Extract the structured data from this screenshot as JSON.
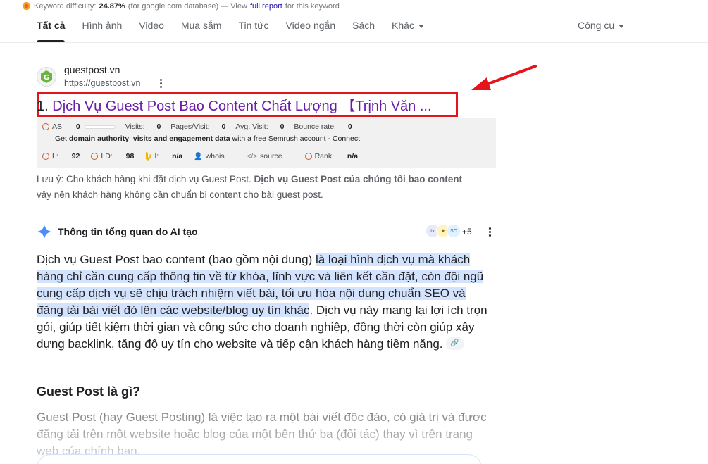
{
  "keyword_difficulty": {
    "label": "Keyword difficulty:",
    "value": "24.87%",
    "note": "(for google.com database) — View",
    "link": "full report",
    "suffix": "for this keyword"
  },
  "tabs": [
    {
      "label": "Tất cả",
      "active": true
    },
    {
      "label": "Hình ảnh"
    },
    {
      "label": "Video"
    },
    {
      "label": "Mua sắm"
    },
    {
      "label": "Tin tức"
    },
    {
      "label": "Video ngắn"
    },
    {
      "label": "Sách"
    },
    {
      "label": "Khác"
    }
  ],
  "tools_label": "Công cụ",
  "result": {
    "site_name": "guestpost.vn",
    "url": "https://guestpost.vn",
    "number": "1.",
    "title": "Dịch Vụ Guest Post Bao Content Chất Lượng 【Trịnh Văn ...",
    "title_color": "#681da8",
    "highlight_color": "#e5141b",
    "semrush": {
      "as_label": "AS:",
      "as_value": "0",
      "visits_label": "Visits:",
      "visits_value": "0",
      "pages_label": "Pages/Visit:",
      "pages_value": "0",
      "avg_label": "Avg. Visit:",
      "avg_value": "0",
      "bounce_label": "Bounce rate:",
      "bounce_value": "0",
      "promo_1": "Get",
      "promo_2": "domain authority",
      "promo_3": ",",
      "promo_4": "visits and engagement data",
      "promo_5": "with a free Semrush account -",
      "connect": "Connect",
      "l_label": "L:",
      "l_value": "92",
      "ld_label": "LD:",
      "ld_value": "98",
      "i_label": "I:",
      "i_value": "n/a",
      "whois": "whois",
      "source": "source",
      "rank_label": "Rank:",
      "rank_value": "n/a"
    },
    "snippet_1": "Lưu ý: Cho khách hàng khi đặt dịch vụ Guest Post.",
    "snippet_bold": "Dịch vụ Guest Post của chúng tôi bao content",
    "snippet_2": "vậy nên khách hàng không cần chuẩn bị content cho bài guest post."
  },
  "ai_overview": {
    "title": "Thông tin tổng quan do AI tạo",
    "more_sources": "+5",
    "para1_plain": "Dịch vụ Guest Post bao content (bao gồm nội dung) ",
    "para1_highlight": "là loại hình dịch vụ mà khách hàng chỉ cần cung cấp thông tin về từ khóa, lĩnh vực và liên kết cần đặt, còn đội ngũ cung cấp dịch vụ sẽ chịu trách nhiệm viết bài, tối ưu hóa nội dung chuẩn SEO và đăng tải bài viết đó lên các website/blog uy tín khác",
    "para1_end": ". Dịch vụ này mang lại lợi ích trọn gói, giúp tiết kiệm thời gian và công sức cho doanh nghiệp, đồng thời còn giúp xây dựng backlink, tăng độ uy tín cho website và tiếp cận khách hàng tiềm năng.",
    "link_chip": "🔗",
    "heading": "Guest Post là gì?",
    "para2": "Guest Post (hay Guest Posting) là việc tạo ra một bài viết độc đáo, có giá trị và được đăng tải trên một website hoặc blog của một bên thứ ba (đối tác) thay vì trên trang web của chính bạn."
  }
}
